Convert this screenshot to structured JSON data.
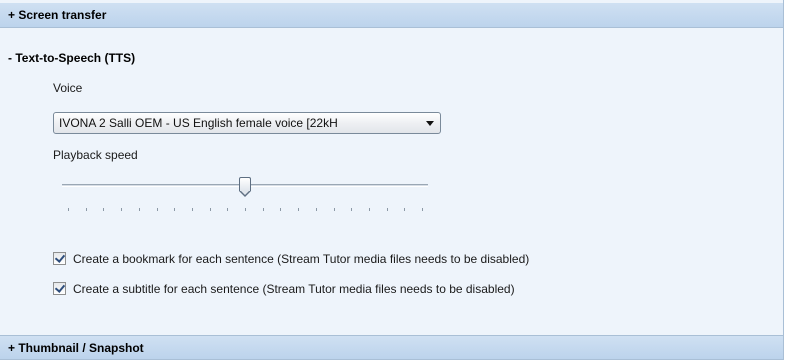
{
  "sections": {
    "screen_transfer": {
      "title": "+ Screen transfer"
    },
    "tts": {
      "title": "- Text-to-Speech (TTS)",
      "voice_label": "Voice",
      "voice_value": "IVONA 2 Salli OEM - US English female voice [22kH",
      "speed_label": "Playback speed",
      "speed_level": 0.5,
      "speed_tick_count": 21,
      "options": [
        {
          "label": "Create a bookmark for each sentence (Stream Tutor media files needs to be disabled)",
          "checked": true
        },
        {
          "label": "Create a subtitle for each sentence (Stream Tutor media files needs to be disabled)",
          "checked": true
        }
      ]
    },
    "thumbnail": {
      "title": "+ Thumbnail / Snapshot"
    }
  },
  "icons": {
    "dropdown": "chevron-down-icon",
    "checkbox": "checkmark-icon"
  }
}
